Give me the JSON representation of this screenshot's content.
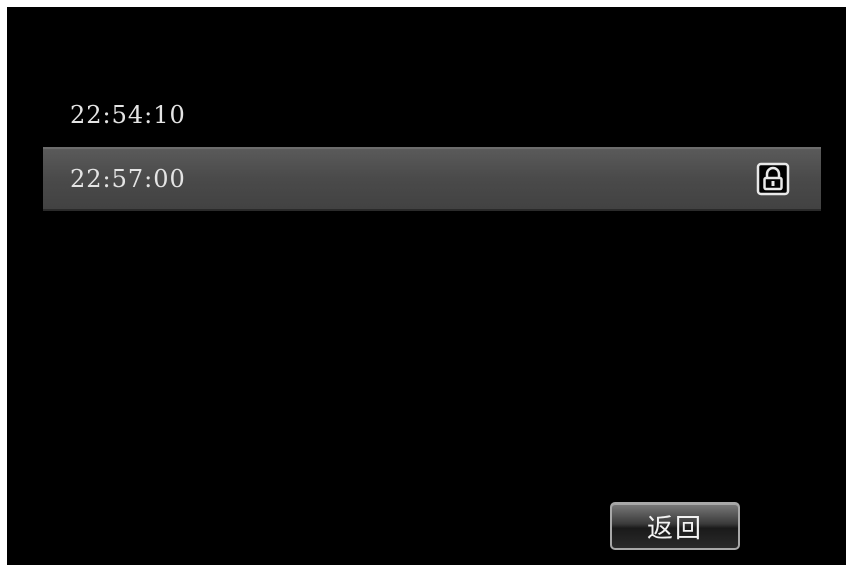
{
  "recordings": [
    {
      "time": "22:54:10",
      "selected": false,
      "locked": false
    },
    {
      "time": "22:57:00",
      "selected": true,
      "locked": true,
      "lock_icon": "lock-icon"
    }
  ],
  "footer": {
    "back_label": "返回"
  },
  "colors": {
    "background": "#000000",
    "selected_row": "#4a4a4a",
    "text": "#e4e4e4"
  }
}
